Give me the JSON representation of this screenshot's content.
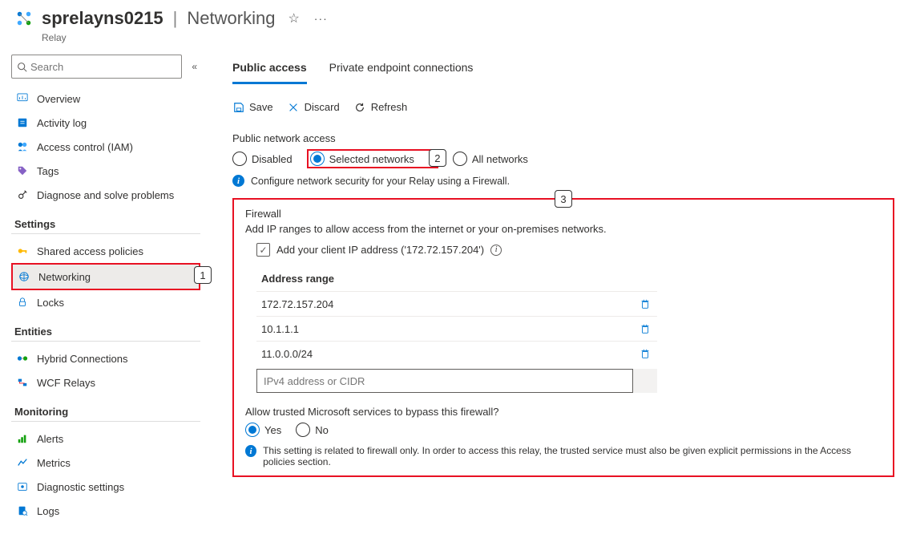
{
  "header": {
    "name": "sprelayns0215",
    "section": "Networking",
    "breadcrumb": "Relay"
  },
  "sidebar": {
    "search_placeholder": "Search",
    "groups": [
      {
        "items": [
          {
            "label": "Overview",
            "icon": "overview"
          },
          {
            "label": "Activity log",
            "icon": "activity"
          },
          {
            "label": "Access control (IAM)",
            "icon": "iam"
          },
          {
            "label": "Tags",
            "icon": "tags"
          },
          {
            "label": "Diagnose and solve problems",
            "icon": "diagnose"
          }
        ]
      },
      {
        "title": "Settings",
        "items": [
          {
            "label": "Shared access policies",
            "icon": "key"
          },
          {
            "label": "Networking",
            "icon": "networking",
            "selected": true
          },
          {
            "label": "Locks",
            "icon": "lock"
          }
        ]
      },
      {
        "title": "Entities",
        "items": [
          {
            "label": "Hybrid Connections",
            "icon": "hybrid"
          },
          {
            "label": "WCF Relays",
            "icon": "wcf"
          }
        ]
      },
      {
        "title": "Monitoring",
        "items": [
          {
            "label": "Alerts",
            "icon": "alerts"
          },
          {
            "label": "Metrics",
            "icon": "metrics"
          },
          {
            "label": "Diagnostic settings",
            "icon": "diagset"
          },
          {
            "label": "Logs",
            "icon": "logs"
          }
        ]
      }
    ]
  },
  "tabs": [
    {
      "label": "Public access",
      "active": true
    },
    {
      "label": "Private endpoint connections"
    }
  ],
  "toolbar": {
    "save": "Save",
    "discard": "Discard",
    "refresh": "Refresh"
  },
  "public_access": {
    "label": "Public network access",
    "options": [
      "Disabled",
      "Selected networks",
      "All networks"
    ],
    "selected": "Selected networks",
    "info": "Configure network security for your Relay using a Firewall."
  },
  "firewall": {
    "title": "Firewall",
    "desc": "Add IP ranges to allow access from the internet or your on-premises networks.",
    "add_client_label": "Add your client IP address ('172.72.157.204')",
    "add_client_checked": true,
    "col_header": "Address range",
    "ranges": [
      "172.72.157.204",
      "10.1.1.1",
      "11.0.0.0/24"
    ],
    "input_placeholder": "IPv4 address or CIDR",
    "trusted_label": "Allow trusted Microsoft services to bypass this firewall?",
    "trusted_options": [
      "Yes",
      "No"
    ],
    "trusted_selected": "Yes",
    "trusted_info": "This setting is related to firewall only. In order to access this relay, the trusted service must also be given explicit permissions in the Access policies section."
  },
  "callouts": {
    "c1": "1",
    "c2": "2",
    "c3": "3"
  }
}
